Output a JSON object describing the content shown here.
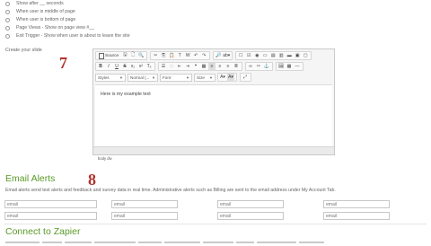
{
  "trigger_options": [
    {
      "label": "Show after __ seconds"
    },
    {
      "label": "When user is middle of page"
    },
    {
      "label": "When user is bottom of page"
    },
    {
      "label": "Page Views - Show on page view #__"
    },
    {
      "label": "Exit Trigger - Show when user is about to leave the site"
    }
  ],
  "create_slide_label": "Create your slide",
  "step_numbers": {
    "editor": "7",
    "email": "8"
  },
  "editor": {
    "source_label": "Source",
    "styles_value": "Styles",
    "format_value": "Normal (...",
    "font_value": "Font",
    "size_value": "Size",
    "content_text": "Here is my example text",
    "status_path": "body  div"
  },
  "email_alerts": {
    "title": "Email Alerts",
    "description": "Email alerts send test alerts and feedback and survey data in real time. Administrative alerts such as Billing are sent to the email address under My Account Tab.",
    "placeholder": "email"
  },
  "zapier": {
    "title": "Connect to Zapier"
  },
  "colors": {
    "accent_green": "#5a9a28",
    "step_red": "#b2312a"
  }
}
